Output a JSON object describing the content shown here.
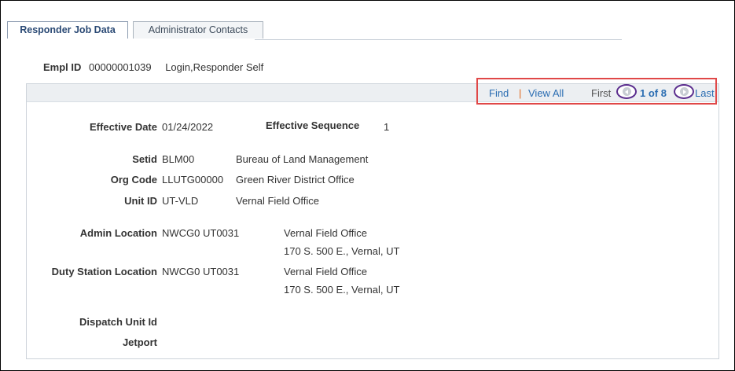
{
  "tabs": [
    {
      "label": "Responder Job Data",
      "active": true
    },
    {
      "label": "Administrator Contacts",
      "active": false
    }
  ],
  "header": {
    "empl_id_label": "Empl ID",
    "empl_id_value": "00000001039",
    "name": "Login,Responder Self"
  },
  "nav": {
    "find": "Find",
    "separator": "|",
    "view_all": "View All",
    "first": "First",
    "position": "1 of 8",
    "last": "Last"
  },
  "fields": {
    "effective_date": {
      "label": "Effective Date",
      "value": "01/24/2022"
    },
    "effective_sequence": {
      "label": "Effective Sequence",
      "value": "1"
    },
    "setid": {
      "label": "Setid",
      "value": "BLM00",
      "desc": "Bureau of Land Management"
    },
    "org_code": {
      "label": "Org Code",
      "value": "LLUTG00000",
      "desc": "Green River District Office"
    },
    "unit_id": {
      "label": "Unit ID",
      "value": "UT-VLD",
      "desc": "Vernal Field Office"
    },
    "admin_location": {
      "label": "Admin Location",
      "value": "NWCG0 UT0031",
      "desc1": "Vernal Field Office",
      "desc2": "170 S. 500 E., Vernal, UT"
    },
    "duty_station": {
      "label": "Duty Station Location",
      "value": "NWCG0 UT0031",
      "desc1": "Vernal Field Office",
      "desc2": "170 S. 500 E., Vernal, UT"
    },
    "dispatch_unit": {
      "label": "Dispatch Unit Id",
      "value": ""
    },
    "jetport": {
      "label": "Jetport",
      "value": ""
    }
  },
  "colors": {
    "link": "#2a6db2",
    "highlight_box": "#e04848",
    "circle_annotation": "#5b2e8e"
  }
}
